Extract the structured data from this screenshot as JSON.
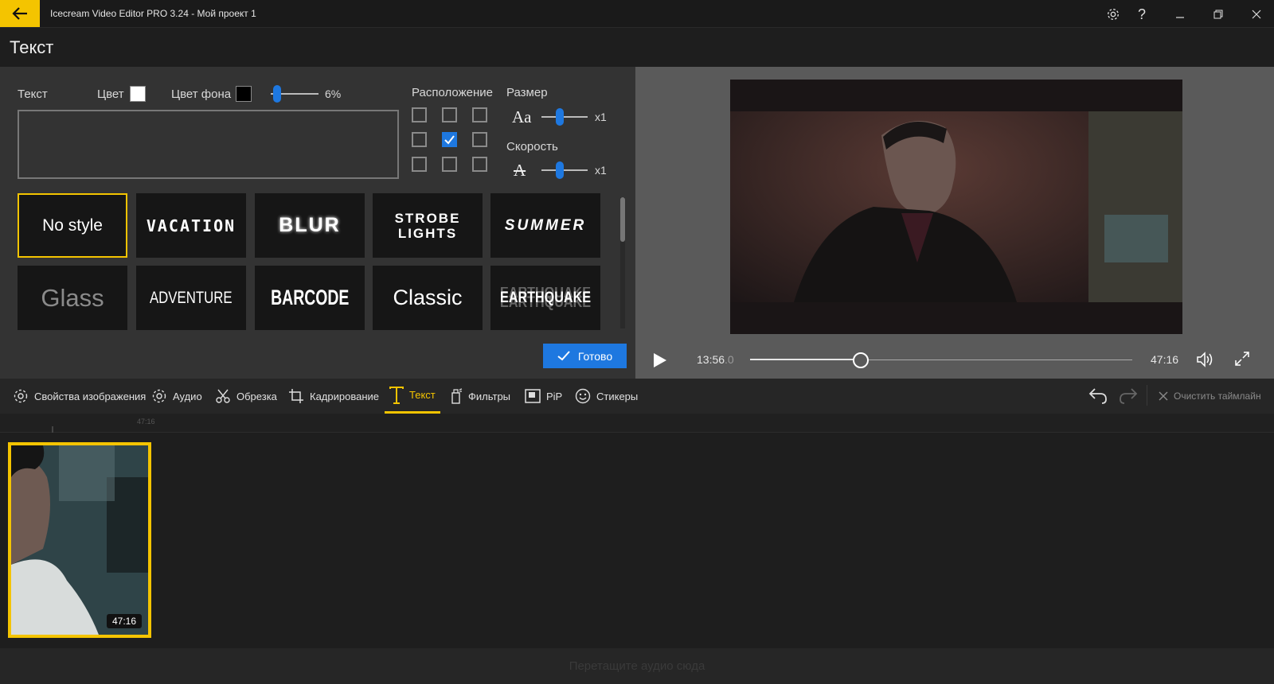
{
  "titlebar": {
    "app_title": "Icecream Video Editor PRO 3.24   -   Мой проект 1"
  },
  "section_title": "Текст",
  "text_panel": {
    "text_label": "Текст",
    "color_label": "Цвет",
    "color_value": "#ffffff",
    "bg_color_label": "Цвет фона",
    "bg_color_value": "#000000",
    "opacity_value": "6%",
    "opacity_level": 0.06,
    "input_value": "",
    "position_label": "Расположение",
    "position_selected": "center",
    "size_label": "Размер",
    "size_value": "x1",
    "speed_label": "Скорость",
    "speed_value": "x1",
    "styles": [
      {
        "label": "No style",
        "selected": true
      },
      {
        "label": "VACATION",
        "selected": false
      },
      {
        "label": "BLUR",
        "selected": false
      },
      {
        "label": "STROBE LIGHTS",
        "selected": false
      },
      {
        "label": "SUMMER",
        "selected": false
      },
      {
        "label": "Glass",
        "selected": false
      },
      {
        "label": "ADVENTURE",
        "selected": false
      },
      {
        "label": "BARCODE",
        "selected": false
      },
      {
        "label": "Classic",
        "selected": false
      },
      {
        "label": "EARTHQUAKE",
        "selected": false
      }
    ],
    "done_label": "Готово"
  },
  "player": {
    "current_time": "13:56",
    "current_frac": ".0",
    "total_time": "47:16",
    "progress": 0.29
  },
  "toolbar": {
    "items": [
      {
        "label": "Свойства изображения",
        "icon": "gear-icon"
      },
      {
        "label": "Аудио",
        "icon": "gear-icon"
      },
      {
        "label": "Обрезка",
        "icon": "scissors-icon"
      },
      {
        "label": "Кадрирование",
        "icon": "crop-icon"
      },
      {
        "label": "Текст",
        "icon": "text-icon",
        "active": true
      },
      {
        "label": "Фильтры",
        "icon": "filter-icon"
      },
      {
        "label": "PiP",
        "icon": "pip-icon"
      },
      {
        "label": "Стикеры",
        "icon": "smiley-icon"
      }
    ],
    "clear_timeline_label": "Очистить таймлайн"
  },
  "timeline": {
    "ruler_mark": "47:16",
    "clip_duration": "47:16",
    "audio_hint": "Перетащите аудио сюда"
  },
  "colors": {
    "accent": "#f4c400",
    "primary_blue": "#1e78e0"
  }
}
